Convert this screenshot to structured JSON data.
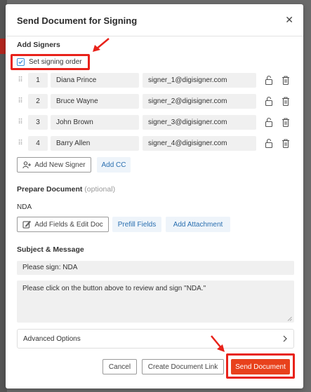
{
  "modal": {
    "title": "Send Document for Signing",
    "close_glyph": "✕"
  },
  "signers_section": {
    "title": "Add Signers",
    "set_signing_order_label": "Set signing order",
    "signers": [
      {
        "order": "1",
        "name": "Diana Prince",
        "email": "signer_1@digisigner.com"
      },
      {
        "order": "2",
        "name": "Bruce Wayne",
        "email": "signer_2@digisigner.com"
      },
      {
        "order": "3",
        "name": "John Brown",
        "email": "signer_3@digisigner.com"
      },
      {
        "order": "4",
        "name": "Barry Allen",
        "email": "signer_4@digisigner.com"
      }
    ],
    "add_signer_label": "Add New Signer",
    "add_cc_label": "Add CC"
  },
  "prepare_section": {
    "title": "Prepare Document",
    "optional": "(optional)",
    "document_name": "NDA",
    "add_fields_label": "Add Fields & Edit Doc",
    "prefill_label": "Prefill Fields",
    "attachment_label": "Add Attachment"
  },
  "message_section": {
    "title": "Subject & Message",
    "subject": "Please sign: NDA",
    "message": "Please click on the button above to review and sign \"NDA.\""
  },
  "advanced_options_label": "Advanced Options",
  "footer": {
    "cancel_label": "Cancel",
    "link_label": "Create Document Link",
    "send_label": "Send Document"
  },
  "colors": {
    "accent": "#e8411c",
    "highlight_box": "#e8221a",
    "link_blue": "#2a6fb0"
  }
}
